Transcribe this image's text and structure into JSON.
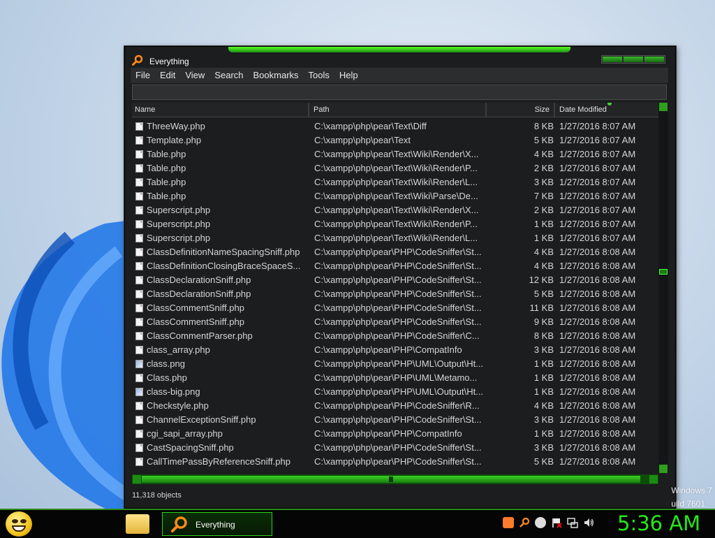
{
  "window": {
    "title": "Everything",
    "menu": [
      "File",
      "Edit",
      "View",
      "Search",
      "Bookmarks",
      "Tools",
      "Help"
    ],
    "search_value": "",
    "columns": {
      "name": "Name",
      "path": "Path",
      "size": "Size",
      "date": "Date Modified"
    },
    "rows": [
      {
        "name": "ThreeWay.php",
        "path": "C:\\xampp\\php\\pear\\Text\\Diff",
        "size": "8 KB",
        "date": "1/27/2016 8:07 AM",
        "type": "php"
      },
      {
        "name": "Template.php",
        "path": "C:\\xampp\\php\\pear\\Text",
        "size": "5 KB",
        "date": "1/27/2016 8:07 AM",
        "type": "php"
      },
      {
        "name": "Table.php",
        "path": "C:\\xampp\\php\\pear\\Text\\Wiki\\Render\\X...",
        "size": "4 KB",
        "date": "1/27/2016 8:07 AM",
        "type": "php"
      },
      {
        "name": "Table.php",
        "path": "C:\\xampp\\php\\pear\\Text\\Wiki\\Render\\P...",
        "size": "2 KB",
        "date": "1/27/2016 8:07 AM",
        "type": "php"
      },
      {
        "name": "Table.php",
        "path": "C:\\xampp\\php\\pear\\Text\\Wiki\\Render\\L...",
        "size": "3 KB",
        "date": "1/27/2016 8:07 AM",
        "type": "php"
      },
      {
        "name": "Table.php",
        "path": "C:\\xampp\\php\\pear\\Text\\Wiki\\Parse\\De...",
        "size": "7 KB",
        "date": "1/27/2016 8:07 AM",
        "type": "php"
      },
      {
        "name": "Superscript.php",
        "path": "C:\\xampp\\php\\pear\\Text\\Wiki\\Render\\X...",
        "size": "2 KB",
        "date": "1/27/2016 8:07 AM",
        "type": "php"
      },
      {
        "name": "Superscript.php",
        "path": "C:\\xampp\\php\\pear\\Text\\Wiki\\Render\\P...",
        "size": "1 KB",
        "date": "1/27/2016 8:07 AM",
        "type": "php"
      },
      {
        "name": "Superscript.php",
        "path": "C:\\xampp\\php\\pear\\Text\\Wiki\\Render\\L...",
        "size": "1 KB",
        "date": "1/27/2016 8:07 AM",
        "type": "php"
      },
      {
        "name": "ClassDefinitionNameSpacingSniff.php",
        "path": "C:\\xampp\\php\\pear\\PHP\\CodeSniffer\\St...",
        "size": "4 KB",
        "date": "1/27/2016 8:08 AM",
        "type": "php"
      },
      {
        "name": "ClassDefinitionClosingBraceSpaceS...",
        "path": "C:\\xampp\\php\\pear\\PHP\\CodeSniffer\\St...",
        "size": "4 KB",
        "date": "1/27/2016 8:08 AM",
        "type": "php"
      },
      {
        "name": "ClassDeclarationSniff.php",
        "path": "C:\\xampp\\php\\pear\\PHP\\CodeSniffer\\St...",
        "size": "12 KB",
        "date": "1/27/2016 8:08 AM",
        "type": "php"
      },
      {
        "name": "ClassDeclarationSniff.php",
        "path": "C:\\xampp\\php\\pear\\PHP\\CodeSniffer\\St...",
        "size": "5 KB",
        "date": "1/27/2016 8:08 AM",
        "type": "php"
      },
      {
        "name": "ClassCommentSniff.php",
        "path": "C:\\xampp\\php\\pear\\PHP\\CodeSniffer\\St...",
        "size": "11 KB",
        "date": "1/27/2016 8:08 AM",
        "type": "php"
      },
      {
        "name": "ClassCommentSniff.php",
        "path": "C:\\xampp\\php\\pear\\PHP\\CodeSniffer\\St...",
        "size": "9 KB",
        "date": "1/27/2016 8:08 AM",
        "type": "php"
      },
      {
        "name": "ClassCommentParser.php",
        "path": "C:\\xampp\\php\\pear\\PHP\\CodeSniffer\\C...",
        "size": "8 KB",
        "date": "1/27/2016 8:08 AM",
        "type": "php"
      },
      {
        "name": "class_array.php",
        "path": "C:\\xampp\\php\\pear\\PHP\\CompatInfo",
        "size": "3 KB",
        "date": "1/27/2016 8:08 AM",
        "type": "php"
      },
      {
        "name": "class.png",
        "path": "C:\\xampp\\php\\pear\\PHP\\UML\\Output\\Ht...",
        "size": "1 KB",
        "date": "1/27/2016 8:08 AM",
        "type": "png"
      },
      {
        "name": "Class.php",
        "path": "C:\\xampp\\php\\pear\\PHP\\UML\\Metamo...",
        "size": "1 KB",
        "date": "1/27/2016 8:08 AM",
        "type": "php"
      },
      {
        "name": "class-big.png",
        "path": "C:\\xampp\\php\\pear\\PHP\\UML\\Output\\Ht...",
        "size": "1 KB",
        "date": "1/27/2016 8:08 AM",
        "type": "png"
      },
      {
        "name": "Checkstyle.php",
        "path": "C:\\xampp\\php\\pear\\PHP\\CodeSniffer\\R...",
        "size": "4 KB",
        "date": "1/27/2016 8:08 AM",
        "type": "php"
      },
      {
        "name": "ChannelExceptionSniff.php",
        "path": "C:\\xampp\\php\\pear\\PHP\\CodeSniffer\\St...",
        "size": "3 KB",
        "date": "1/27/2016 8:08 AM",
        "type": "php"
      },
      {
        "name": "cgi_sapi_array.php",
        "path": "C:\\xampp\\php\\pear\\PHP\\CompatInfo",
        "size": "1 KB",
        "date": "1/27/2016 8:08 AM",
        "type": "php"
      },
      {
        "name": "CastSpacingSniff.php",
        "path": "C:\\xampp\\php\\pear\\PHP\\CodeSniffer\\St...",
        "size": "3 KB",
        "date": "1/27/2016 8:08 AM",
        "type": "php"
      },
      {
        "name": "CallTimePassByReferenceSniff.php",
        "path": "C:\\xampp\\php\\pear\\PHP\\CodeSniffer\\St...",
        "size": "5 KB",
        "date": "1/27/2016 8:08 AM",
        "type": "php"
      }
    ],
    "status": "11,318 objects"
  },
  "desktop": {
    "watermark_line1": "Windows 7",
    "watermark_line2": "uild 7601"
  },
  "taskbar": {
    "task_label": "Everything",
    "clock": "5:36 AM",
    "tray_icons": [
      "app-icon",
      "search-icon",
      "messenger-icon",
      "flag-icon",
      "network-icon",
      "volume-icon"
    ]
  },
  "colors": {
    "accent": "#2fd11a",
    "window_bg": "#1b1d1f",
    "text": "#d6d6d6"
  }
}
